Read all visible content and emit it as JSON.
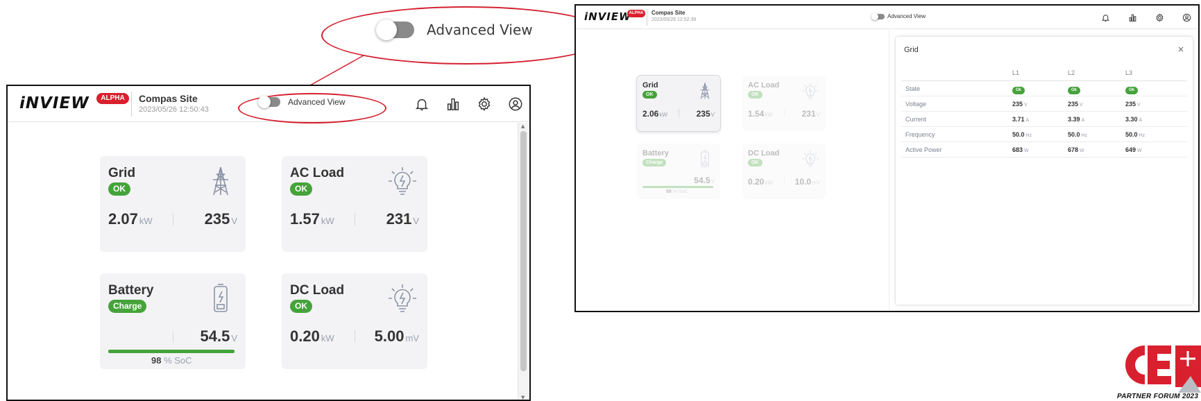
{
  "callout": {
    "label": "Advanced View"
  },
  "left_window": {
    "header": {
      "logo": "iNVIEW",
      "alpha_badge": "ALPHA",
      "site_name": "Compas Site",
      "timestamp": "2023/05/26 12:50:43",
      "toggle_label": "Advanced View",
      "icons": [
        "bell-icon",
        "chart-icon",
        "gear-icon",
        "user-icon"
      ]
    },
    "cards": {
      "grid": {
        "title": "Grid",
        "status": "OK",
        "power": "2.07",
        "power_unit": "kW",
        "voltage": "235",
        "voltage_unit": "V"
      },
      "ac_load": {
        "title": "AC Load",
        "status": "OK",
        "power": "1.57",
        "power_unit": "kW",
        "voltage": "231",
        "voltage_unit": "V"
      },
      "battery": {
        "title": "Battery",
        "status": "Charge",
        "voltage": "54.5",
        "voltage_unit": "V",
        "soc": "98",
        "soc_unit": "% SoC",
        "soc_fraction": 0.98
      },
      "dc_load": {
        "title": "DC Load",
        "status": "OK",
        "power": "0.20",
        "power_unit": "kW",
        "voltage": "5.00",
        "voltage_unit": "mV"
      }
    }
  },
  "right_window": {
    "header": {
      "logo": "iNVIEW",
      "alpha_badge": "ALPHA",
      "site_name": "Compas Site",
      "timestamp": "2023/05/26 12:52:38",
      "toggle_label": "Advanced View"
    },
    "cards": {
      "grid": {
        "title": "Grid",
        "status": "OK",
        "power": "2.06",
        "power_unit": "kW",
        "voltage": "235",
        "voltage_unit": "V"
      },
      "ac_load": {
        "title": "AC Load",
        "status": "OK",
        "power": "1.54",
        "power_unit": "kW",
        "voltage": "231",
        "voltage_unit": "V"
      },
      "battery": {
        "title": "Battery",
        "status": "Charge",
        "voltage": "54.5",
        "voltage_unit": "V",
        "soc": "98",
        "soc_unit": "% SoC",
        "soc_fraction": 0.98
      },
      "dc_load": {
        "title": "DC Load",
        "status": "OK",
        "power": "0.20",
        "power_unit": "kW",
        "voltage": "10.0",
        "voltage_unit": "mV"
      }
    },
    "detail": {
      "title": "Grid",
      "close": "×",
      "columns": [
        "",
        "L1",
        "L2",
        "L3"
      ],
      "rows": [
        {
          "label": "State",
          "type": "badge",
          "values": [
            "Ok",
            "Ok",
            "Ok"
          ]
        },
        {
          "label": "Voltage",
          "unit": "V",
          "values": [
            "235",
            "235",
            "235"
          ]
        },
        {
          "label": "Current",
          "unit": "A",
          "values": [
            "3.71",
            "3.39",
            "3.30"
          ]
        },
        {
          "label": "Frequency",
          "unit": "Hz",
          "values": [
            "50.0",
            "50.0",
            "50.0"
          ]
        },
        {
          "label": "Active Power",
          "unit": "W",
          "values": [
            "683",
            "678",
            "649"
          ]
        }
      ]
    }
  },
  "brand": {
    "logo_text": "CE+T",
    "tagline": "PARTNER FORUM 2023"
  },
  "colors": {
    "accent_red": "#d8202e",
    "status_green": "#45a33a",
    "card_bg": "#f3f3f5",
    "icon_gray": "#8b93a6"
  }
}
